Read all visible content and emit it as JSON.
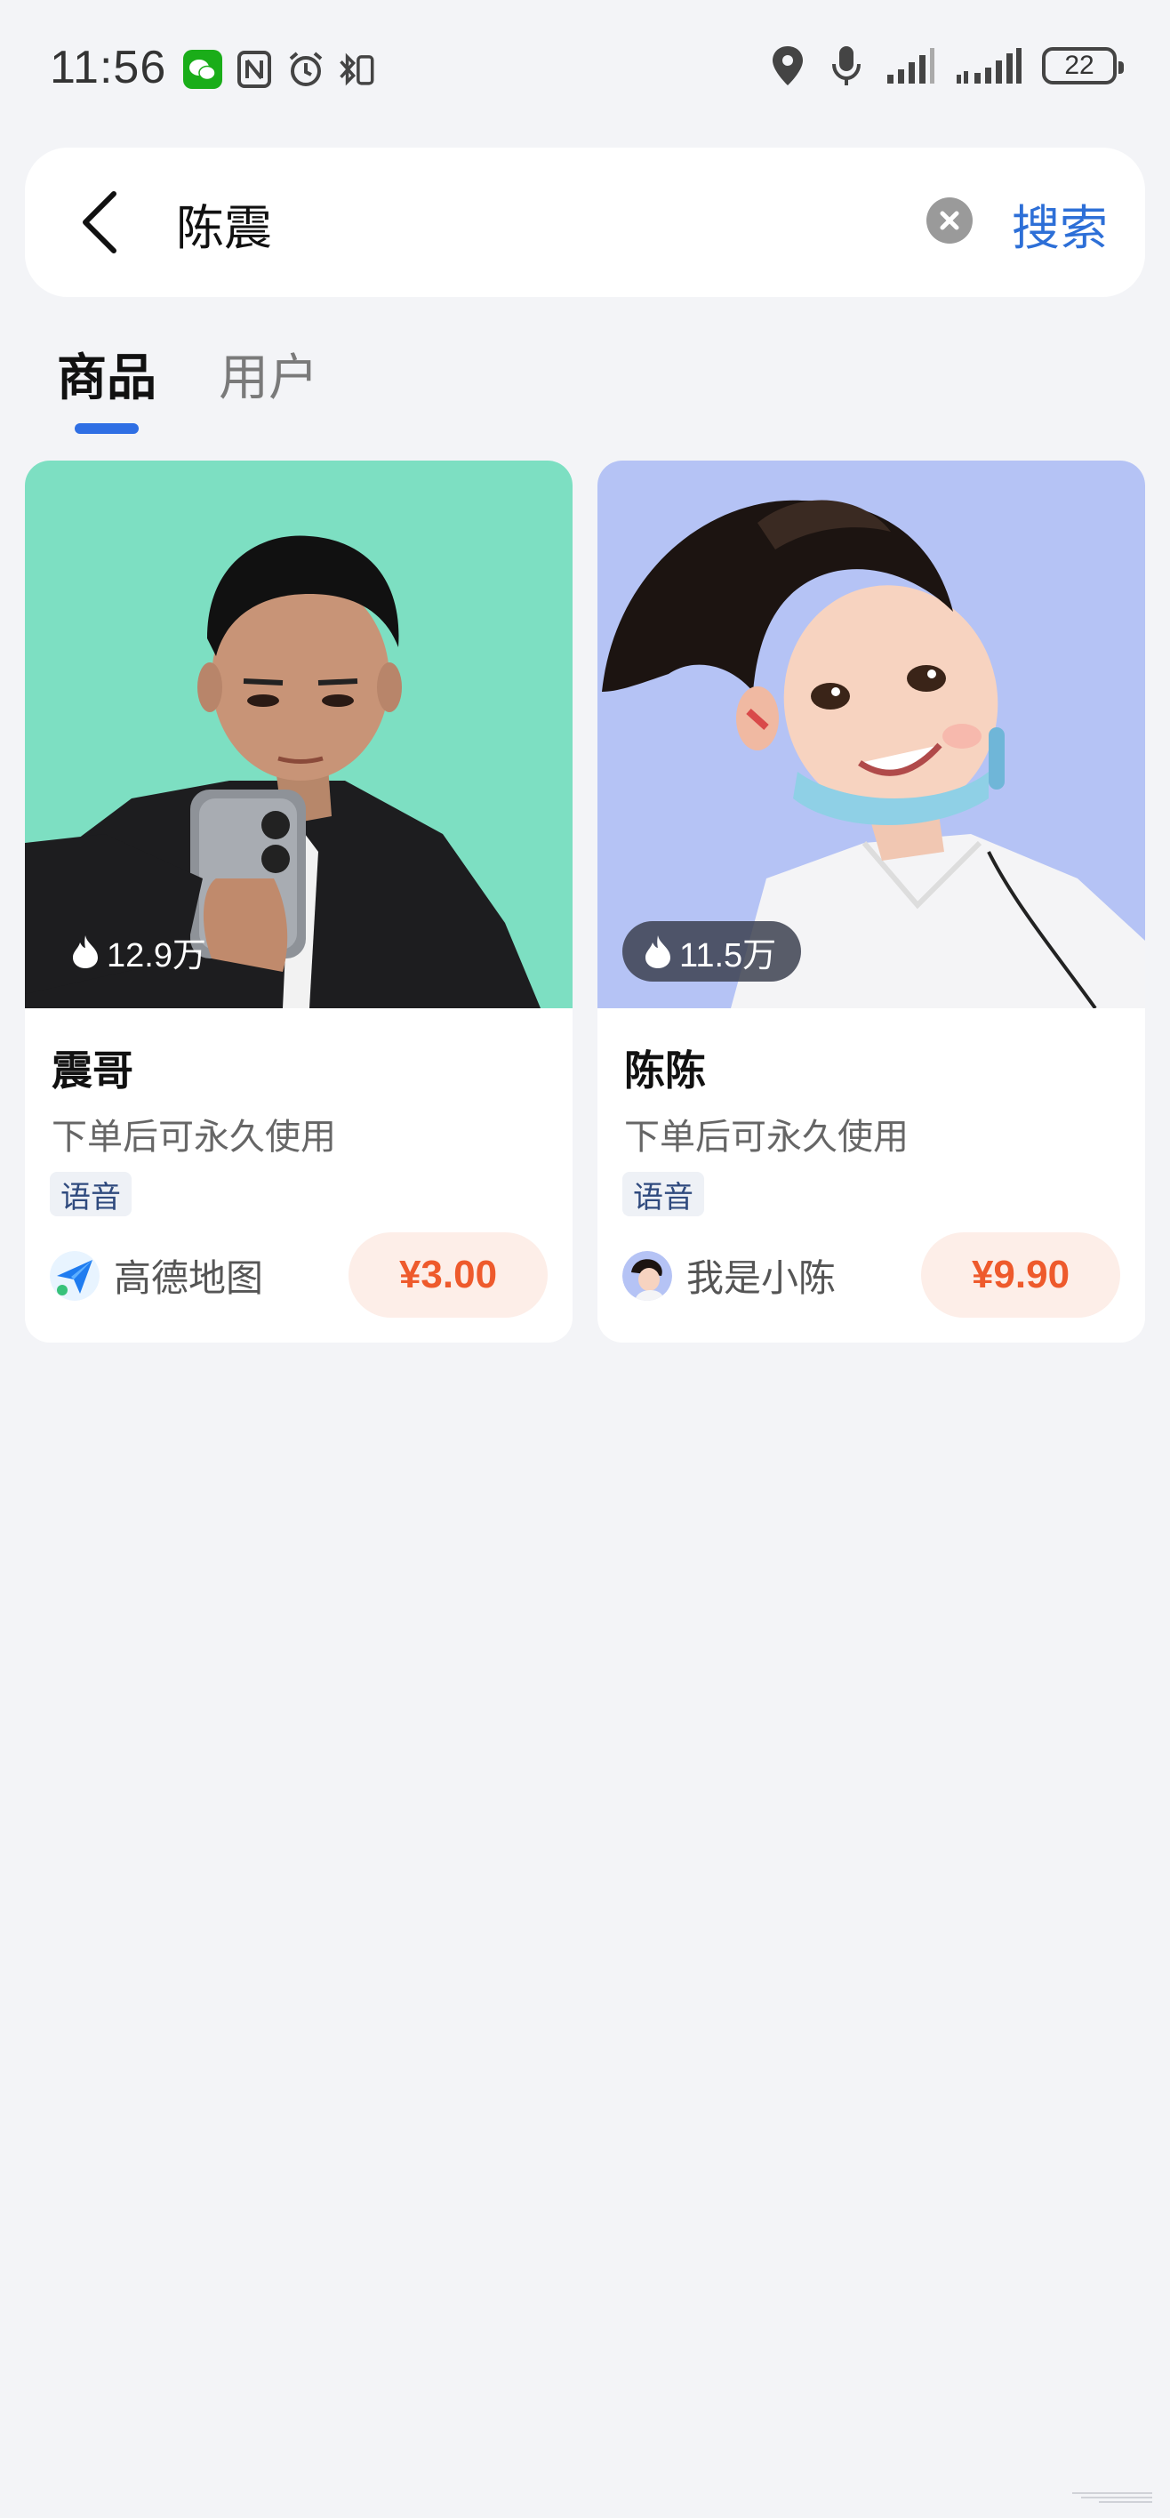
{
  "status_bar": {
    "time": "11:56",
    "battery": "22",
    "left_icons": [
      "wechat-icon",
      "nfc-icon",
      "alarm-icon",
      "bluetooth-vibrate-icon"
    ],
    "right_icons": [
      "location-icon",
      "mic-icon",
      "signal-icon",
      "signal-icon-2"
    ]
  },
  "search": {
    "query": "陈震",
    "action_label": "搜索"
  },
  "tabs": [
    {
      "label": "商品",
      "active": true
    },
    {
      "label": "用户",
      "active": false
    }
  ],
  "products": [
    {
      "heat": "12.9万",
      "name": "震哥",
      "desc": "下单后可永久使用",
      "tag": "语音",
      "seller": "高德地图",
      "price": "¥3.00",
      "image_bg": "#7ddfc2"
    },
    {
      "heat": "11.5万",
      "name": "陈陈",
      "desc": "下单后可永久使用",
      "tag": "语音",
      "seller": "我是小陈",
      "price": "¥9.90",
      "image_bg": "#b5c3f5"
    }
  ],
  "colors": {
    "accent": "#2f6fe4",
    "price": "#ee5a2c",
    "price_bg": "#fdeee8",
    "page_bg": "#f3f4f7"
  }
}
